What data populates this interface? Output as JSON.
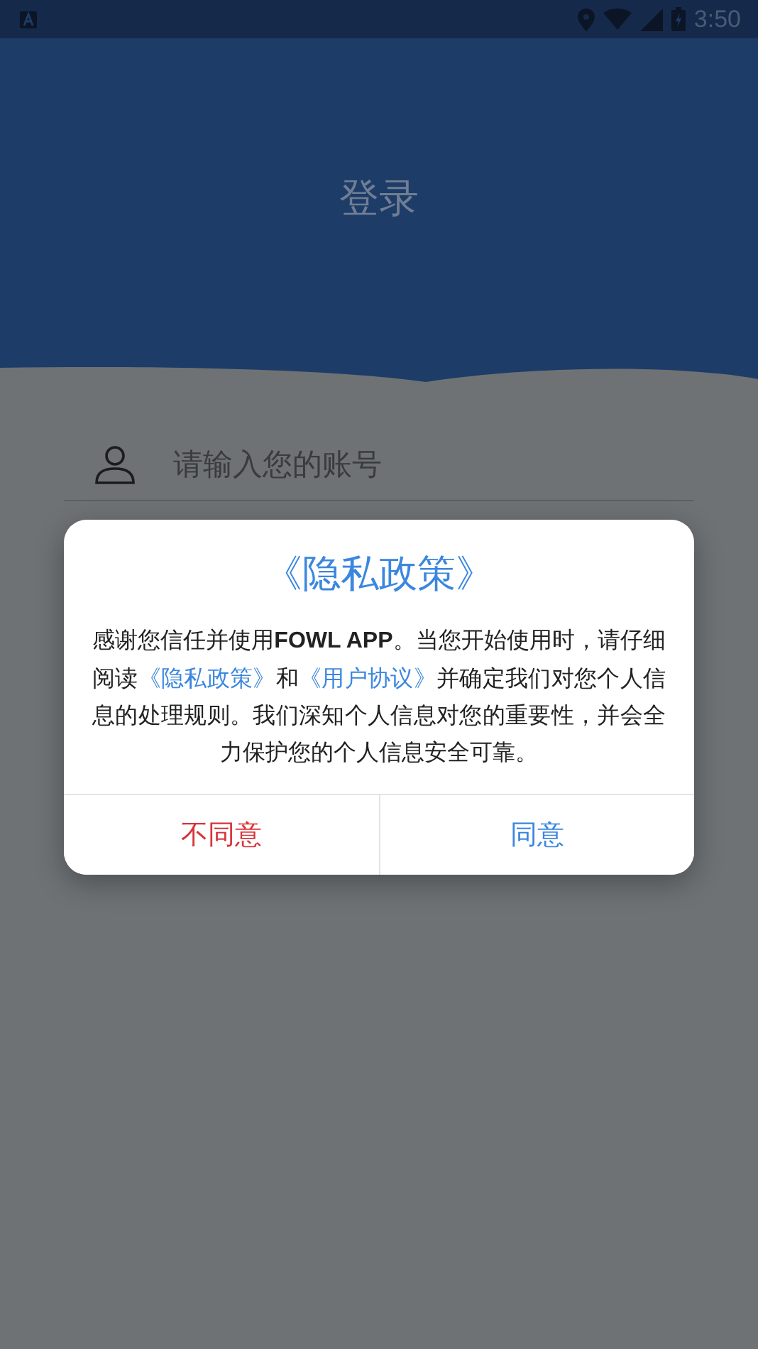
{
  "status_bar": {
    "time": "3:50"
  },
  "header": {
    "title": "登录"
  },
  "account_field": {
    "placeholder": "请输入您的账号"
  },
  "dialog": {
    "title": "《隐私政策》",
    "body": [
      {
        "kind": "text",
        "text": "感谢您信任并使用**FOWL APP**。当您开始使用时，请仔细阅读"
      },
      {
        "kind": "link",
        "text": "《隐私政策》"
      },
      {
        "kind": "text",
        "text": "和"
      },
      {
        "kind": "link",
        "text": "《用户协议》"
      },
      {
        "kind": "text",
        "text": "并确定我们对您个人信息的处理规则。我们深知个人信息对您的重要性，并会全力保护您的个人信息安全可靠。"
      }
    ],
    "buttons": [
      {
        "label": "不同意",
        "kind": "decline"
      },
      {
        "label": "同意",
        "kind": "accept"
      }
    ]
  }
}
